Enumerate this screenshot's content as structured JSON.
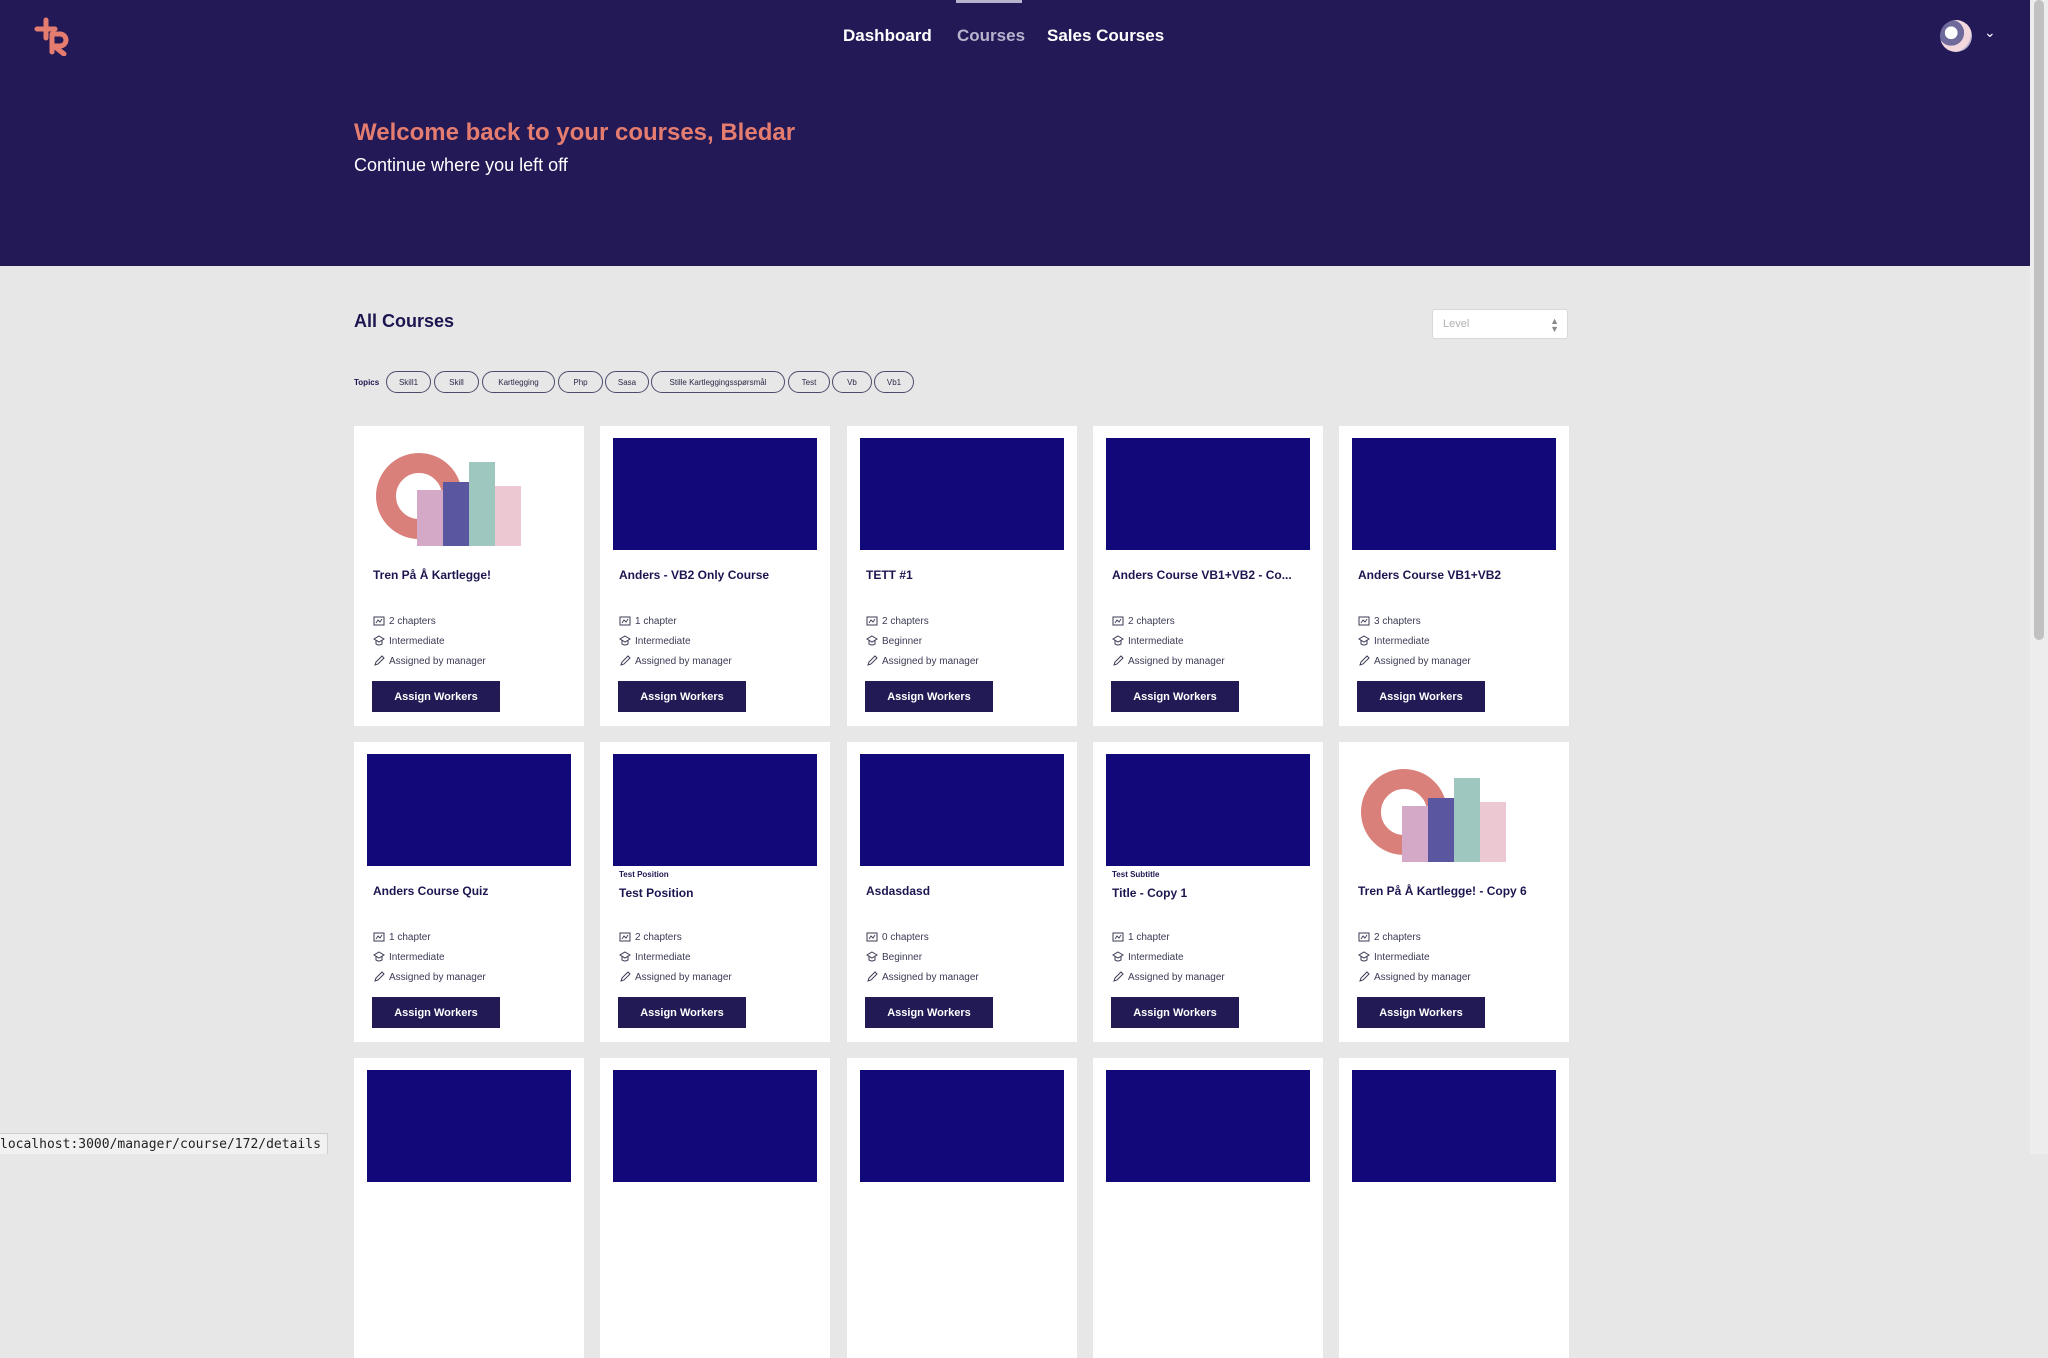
{
  "nav": {
    "items": [
      {
        "label": "Dashboard",
        "active": false
      },
      {
        "label": "Courses",
        "active": true
      },
      {
        "label": "Sales Courses",
        "active": false
      }
    ]
  },
  "hero": {
    "welcome": "Welcome back to your courses, Bledar",
    "subtitle": "Continue where you left off"
  },
  "section": {
    "title": "All Courses",
    "level_placeholder": "Level"
  },
  "topics": {
    "label": "Topics",
    "chips": [
      "Skill1",
      "Skill",
      "Kartlegging",
      "Php",
      "Sasa",
      "Stille Kartleggingsspørsmål",
      "Test",
      "Vb",
      "Vb1"
    ]
  },
  "colors": {
    "header_bg": "#231956",
    "accent": "#e47d6f",
    "thumbnail": "#11097a",
    "button": "#211a55",
    "page_bg": "#e7e7e7"
  },
  "icons": {
    "chapters": "book-icon",
    "level": "level-badge-icon",
    "assigned": "pencil-icon",
    "avatar_caret": "chevron-down-icon"
  },
  "assign_label": "Assign Workers",
  "courses": [
    {
      "title": "Tren På Å Kartlegge!",
      "subtitle": "",
      "thumbnail": "illustration",
      "chapters": "2 chapters",
      "level": "Intermediate",
      "assigned": "Assigned by manager"
    },
    {
      "title": "Anders - VB2 Only Course",
      "subtitle": "",
      "thumbnail": "solid",
      "chapters": "1 chapter",
      "level": "Intermediate",
      "assigned": "Assigned by manager"
    },
    {
      "title": "TETT #1",
      "subtitle": "",
      "thumbnail": "solid",
      "chapters": "2 chapters",
      "level": "Beginner",
      "assigned": "Assigned by manager"
    },
    {
      "title": "Anders Course VB1+VB2 - Co...",
      "subtitle": "",
      "thumbnail": "solid",
      "chapters": "2 chapters",
      "level": "Intermediate",
      "assigned": "Assigned by manager"
    },
    {
      "title": "Anders Course VB1+VB2",
      "subtitle": "",
      "thumbnail": "solid",
      "chapters": "3 chapters",
      "level": "Intermediate",
      "assigned": "Assigned by manager"
    },
    {
      "title": "Anders Course Quiz",
      "subtitle": "",
      "thumbnail": "solid",
      "chapters": "1 chapter",
      "level": "Intermediate",
      "assigned": "Assigned by manager"
    },
    {
      "title": "Test Position",
      "subtitle": "Test Position",
      "thumbnail": "solid",
      "chapters": "2 chapters",
      "level": "Intermediate",
      "assigned": "Assigned by manager"
    },
    {
      "title": "Asdasdasd",
      "subtitle": "",
      "thumbnail": "solid",
      "chapters": "0 chapters",
      "level": "Beginner",
      "assigned": "Assigned by manager"
    },
    {
      "title": "Title - Copy 1",
      "subtitle": "Test Subtitle",
      "thumbnail": "solid",
      "chapters": "1 chapter",
      "level": "Intermediate",
      "assigned": "Assigned by manager"
    },
    {
      "title": "Tren På Å Kartlegge! - Copy 6",
      "subtitle": "",
      "thumbnail": "illustration",
      "chapters": "2 chapters",
      "level": "Intermediate",
      "assigned": "Assigned by manager"
    },
    {
      "title": "",
      "subtitle": "",
      "thumbnail": "solid"
    },
    {
      "title": "",
      "subtitle": "",
      "thumbnail": "solid"
    },
    {
      "title": "",
      "subtitle": "",
      "thumbnail": "solid"
    },
    {
      "title": "",
      "subtitle": "",
      "thumbnail": "solid"
    },
    {
      "title": "",
      "subtitle": "",
      "thumbnail": "solid"
    }
  ],
  "status_bar": {
    "url": "localhost:3000/manager/course/172/details"
  }
}
